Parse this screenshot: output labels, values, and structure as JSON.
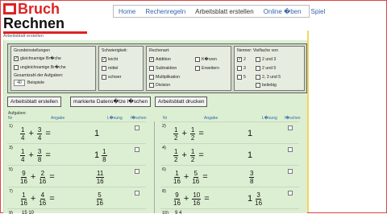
{
  "logo": {
    "line1": "Bruch",
    "line2": "Rechnen"
  },
  "nav": [
    "Home",
    "Rechenregeln",
    "Arbeitsblatt erstellen",
    "Online �ben",
    "Spiel"
  ],
  "breadcrumb": "Arbeitsblatt erstellen",
  "settings": {
    "grund": {
      "title": "Grundeinstellungen",
      "opt1": "gleichnamige Br�che",
      "opt2": "ungleichnamige Br�che",
      "count_label": "Gesamtzahl der Aufgaben:",
      "count_value": "40",
      "count_unit": "Beispiele"
    },
    "schwierigkeit": {
      "title": "Schwierigkeit:",
      "opts": [
        "leicht",
        "mittel",
        "schwer"
      ]
    },
    "rechenart": {
      "title": "Rechenart:",
      "opts": [
        "Addition",
        "Subtraktion",
        "Multiplikation",
        "Division",
        "K�rzen",
        "Erweitern"
      ]
    },
    "nenner": {
      "title": "Nenner: Vielfache von",
      "opts": [
        "2",
        "3",
        "5",
        "2 und 3",
        "2 und 5",
        "2, 3 und 5",
        "beliebig"
      ]
    }
  },
  "buttons": {
    "create": "Arbeitsblatt erstellen",
    "delete_marked": "markierte Datens�tze l�schen",
    "print": "Arbeitsblatt drucken"
  },
  "table": {
    "aufgaben_label": "Aufgaben:",
    "headers": {
      "nr": "Nr",
      "angabe": "Angabe",
      "loesung": "L�sung",
      "loeschen": "l�schen"
    },
    "left": [
      {
        "nr": "1)",
        "a": [
          "1",
          "4"
        ],
        "b": [
          "3",
          "4"
        ],
        "sol": {
          "whole": "1",
          "frac": null
        }
      },
      {
        "nr": "3)",
        "a": [
          "1",
          "4"
        ],
        "b": [
          "3",
          "8"
        ],
        "sol": {
          "whole": "1",
          "frac": [
            "1",
            "8"
          ]
        }
      },
      {
        "nr": "5)",
        "a": [
          "9",
          "16"
        ],
        "b": [
          "2",
          "16"
        ],
        "sol": {
          "whole": "",
          "frac": [
            "11",
            "16"
          ]
        }
      },
      {
        "nr": "7)",
        "a": [
          "1",
          "16"
        ],
        "b": [
          "4",
          "16"
        ],
        "sol": {
          "whole": "",
          "frac": [
            "5",
            "16"
          ]
        }
      }
    ],
    "right": [
      {
        "nr": "2)",
        "a": [
          "1",
          "2"
        ],
        "b": [
          "1",
          "2"
        ],
        "sol": {
          "whole": "1",
          "frac": null
        }
      },
      {
        "nr": "4)",
        "a": [
          "1",
          "2"
        ],
        "b": [
          "1",
          "2"
        ],
        "sol": {
          "whole": "1",
          "frac": null
        }
      },
      {
        "nr": "6)",
        "a": [
          "1",
          "16"
        ],
        "b": [
          "5",
          "16"
        ],
        "sol": {
          "whole": "",
          "frac": [
            "3",
            "8"
          ]
        }
      },
      {
        "nr": "8)",
        "a": [
          "9",
          "16"
        ],
        "b": [
          "10",
          "16"
        ],
        "sol": {
          "whole": "1",
          "frac": [
            "3",
            "16"
          ]
        }
      }
    ],
    "partial_left": {
      "nr": "9)",
      "a": "15",
      "b": "10"
    },
    "partial_right": {
      "nr": "10)",
      "a": "9",
      "b": "4"
    }
  },
  "colors": {
    "brand_red": "#d22",
    "panel_green": "#dcefd2",
    "link_blue": "#36a"
  }
}
